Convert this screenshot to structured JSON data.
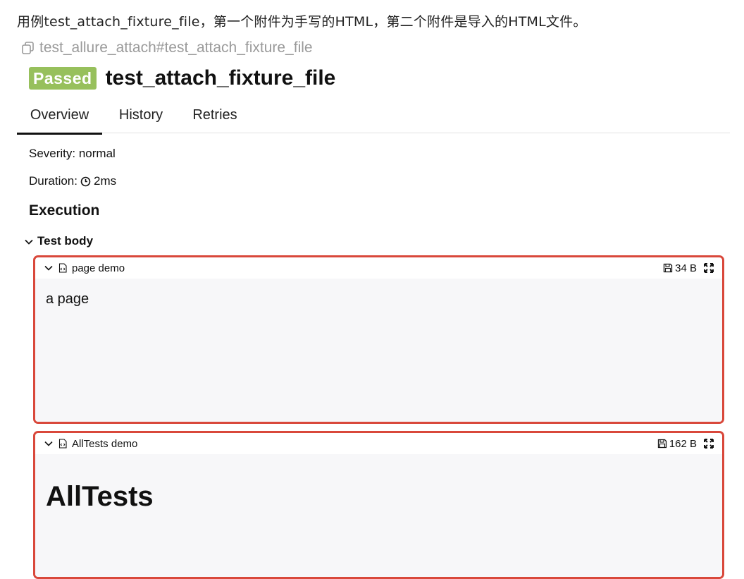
{
  "caption": "用例test_attach_fixture_file，第一个附件为手写的HTML，第二个附件是导入的HTML文件。",
  "test": {
    "full_name": "test_allure_attach#test_attach_fixture_file",
    "status": "Passed",
    "name": "test_attach_fixture_file"
  },
  "tabs": [
    {
      "label": "Overview",
      "active": true
    },
    {
      "label": "History",
      "active": false
    },
    {
      "label": "Retries",
      "active": false
    }
  ],
  "severity": "Severity: normal",
  "duration": {
    "label": "Duration:",
    "value": "2ms"
  },
  "execution": {
    "title": "Execution",
    "step": "Test body",
    "attachments": [
      {
        "name": "page demo",
        "size": "34 B",
        "content": "a page"
      },
      {
        "name": "AllTests demo",
        "size": "162 B",
        "content": "AllTests"
      }
    ]
  },
  "colors": {
    "passed": "#97c05c",
    "highlight_border": "#d9483b",
    "attachment_bg": "#f7f7f9"
  },
  "icons": [
    "copy-icon",
    "clock-icon",
    "chevron-down-icon",
    "html-file-icon",
    "save-icon",
    "expand-icon"
  ]
}
